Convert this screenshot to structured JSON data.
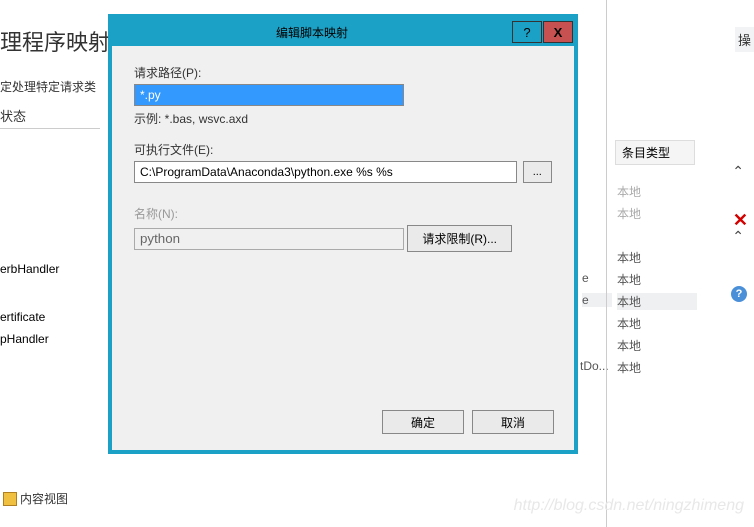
{
  "background": {
    "title": "理程序映射",
    "subtitle": "定处理特定请求类",
    "status_label": "状态",
    "handlers": [
      "erbHandler",
      "ertificate",
      "pHandler"
    ],
    "column_header": "条目类型",
    "cells_faded": [
      "本地",
      "本地"
    ],
    "cells": [
      "本地",
      "本地",
      "本地",
      "本地",
      "本地",
      "本地"
    ],
    "partial_col_e": [
      "e",
      "e",
      "tDo..."
    ],
    "right_title": "操",
    "content_view": "内容视图"
  },
  "dialog": {
    "title": "编辑脚本映射",
    "help_btn": "?",
    "close_btn": "X",
    "path_label": "请求路径(P):",
    "path_value": "*.py",
    "path_hint": "示例: *.bas, wsvc.axd",
    "exec_label": "可执行文件(E):",
    "exec_value": "C:\\ProgramData\\Anaconda3\\python.exe %s %s",
    "browse_btn": "...",
    "name_label": "名称(N):",
    "name_value": "python",
    "request_limit_btn": "请求限制(R)...",
    "ok_btn": "确定",
    "cancel_btn": "取消"
  },
  "watermark": "http://blog.csdn.net/ningzhimeng"
}
